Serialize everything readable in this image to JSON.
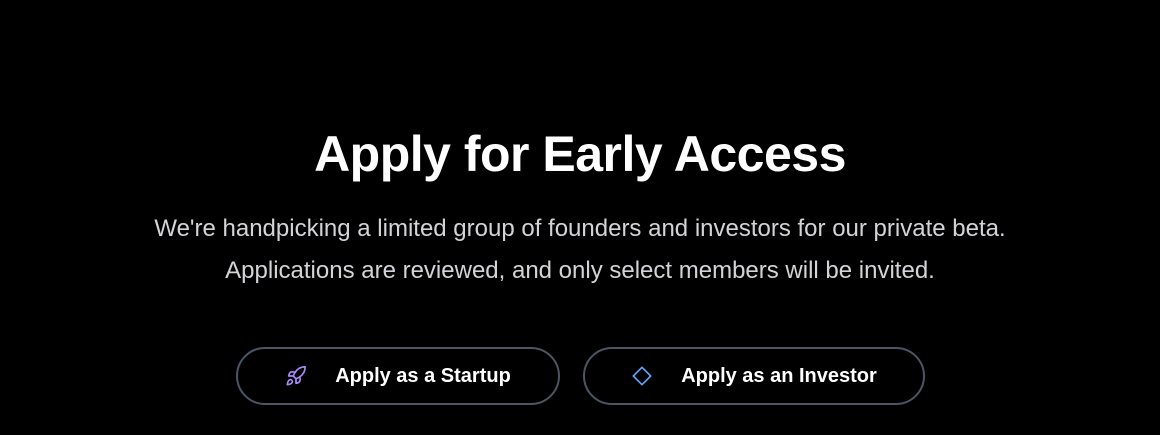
{
  "hero": {
    "title": "Apply for Early Access",
    "subtitle_line1": "We're handpicking a limited group of founders and investors for our private beta.",
    "subtitle_line2": "Applications are reviewed, and only select members will be invited."
  },
  "actions": {
    "startup": {
      "label": "Apply as a Startup",
      "icon": "rocket-icon",
      "icon_color": "#a78bfa"
    },
    "investor": {
      "label": "Apply as an Investor",
      "icon": "diamond-icon",
      "icon_color": "#60a5fa"
    }
  },
  "colors": {
    "background": "#000000",
    "button_border": "#4b5563",
    "subtitle": "#d4d4d8"
  }
}
